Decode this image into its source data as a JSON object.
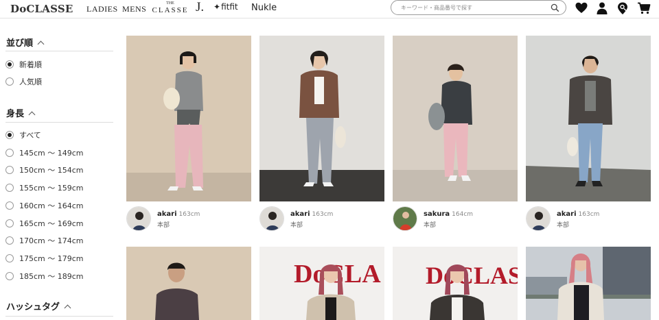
{
  "header": {
    "logo": "DoCLASSE",
    "nav": {
      "ladies": "LADIES",
      "mens": "MENS",
      "classe_the": "THE",
      "classe_name": "CLASSE",
      "j": "J.",
      "fitfit": "fitfit",
      "nukle": "Nukle"
    },
    "search_placeholder": "キーワード・商品番号で探す",
    "icons": [
      "heart-icon",
      "user-icon",
      "store-search-icon",
      "cart-icon"
    ]
  },
  "sidebar": {
    "sort": {
      "title": "並び順",
      "options": [
        {
          "label": "新着順",
          "selected": true
        },
        {
          "label": "人気順",
          "selected": false
        }
      ]
    },
    "height": {
      "title": "身長",
      "options": [
        {
          "label": "すべて",
          "selected": true
        },
        {
          "label": "145cm 〜 149cm",
          "selected": false
        },
        {
          "label": "150cm 〜 154cm",
          "selected": false
        },
        {
          "label": "155cm 〜 159cm",
          "selected": false
        },
        {
          "label": "160cm 〜 164cm",
          "selected": false
        },
        {
          "label": "165cm 〜 169cm",
          "selected": false
        },
        {
          "label": "170cm 〜 174cm",
          "selected": false
        },
        {
          "label": "175cm 〜 179cm",
          "selected": false
        },
        {
          "label": "185cm 〜 189cm",
          "selected": false
        }
      ]
    },
    "hashtag": {
      "title": "ハッシュタグ"
    }
  },
  "cards": [
    {
      "name": "akari",
      "height": "163cm",
      "shop": "本部"
    },
    {
      "name": "akari",
      "height": "163cm",
      "shop": "本部"
    },
    {
      "name": "sakura",
      "height": "164cm",
      "shop": "本部"
    },
    {
      "name": "akari",
      "height": "163cm",
      "shop": "本部"
    }
  ],
  "row2": {
    "banner_text": "DoCLA",
    "banner_text_2": "DoCLAS"
  },
  "colors": {
    "accent_red": "#b31b2a",
    "text": "#222222",
    "divider": "#dddddd"
  }
}
